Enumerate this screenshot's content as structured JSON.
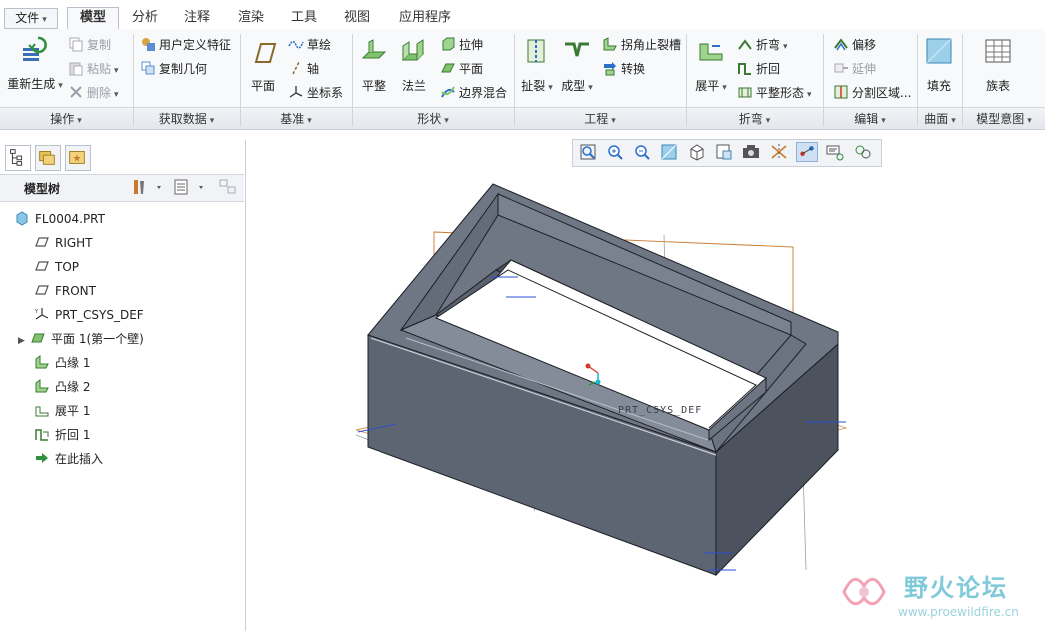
{
  "menu": {
    "file": "文件",
    "tabs": [
      "模型",
      "分析",
      "注释",
      "渲染",
      "工具",
      "视图",
      "应用程序"
    ],
    "active_tab": "模型"
  },
  "ribbon": {
    "operations": {
      "regenerate": "重新生成",
      "copy": "复制",
      "paste": "粘贴",
      "delete": "删除",
      "label": "操作"
    },
    "get_data": {
      "udf": "用户定义特征",
      "copy_geom": "复制几何",
      "label": "获取数据"
    },
    "datum": {
      "plane": "平面",
      "sketch": "草绘",
      "axis": "轴",
      "csys": "坐标系",
      "label": "基准"
    },
    "shapes": {
      "flat": "平整",
      "flange": "法兰",
      "extrude": "拉伸",
      "planar": "平面",
      "blend": "边界混合",
      "label": "形状"
    },
    "engineering": {
      "rip": "扯裂",
      "form": "成型",
      "corner_relief": "拐角止裂槽",
      "convert": "转换",
      "label": "工程"
    },
    "bend": {
      "unbend": "展平",
      "bend": "折弯",
      "bend_back": "折回",
      "flat_state": "平整形态",
      "label": "折弯"
    },
    "edit": {
      "offset": "偏移",
      "extend": "延伸",
      "split": "分割区域...",
      "label": "编辑"
    },
    "surface": {
      "fill": "填充",
      "label": "曲面"
    },
    "model_intent": {
      "family": "族表",
      "label": "模型意图"
    }
  },
  "tree": {
    "title": "模型树",
    "items": [
      {
        "label": "FL0004.PRT",
        "icon": "part-icon"
      },
      {
        "label": "RIGHT",
        "icon": "datum-plane-icon"
      },
      {
        "label": "TOP",
        "icon": "datum-plane-icon"
      },
      {
        "label": "FRONT",
        "icon": "datum-plane-icon"
      },
      {
        "label": "PRT_CSYS_DEF",
        "icon": "csys-icon"
      },
      {
        "label": "平面 1(第一个壁)",
        "icon": "flat-wall-icon"
      },
      {
        "label": "凸缘 1",
        "icon": "flange-icon"
      },
      {
        "label": "凸缘 2",
        "icon": "flange-icon"
      },
      {
        "label": "展平 1",
        "icon": "unbend-icon"
      },
      {
        "label": "折回 1",
        "icon": "bendback-icon"
      },
      {
        "label": "在此插入",
        "icon": "insert-arrow-icon"
      }
    ]
  },
  "viewport": {
    "csys_label": "PRT_CSYS_DEF"
  },
  "watermark": {
    "cn": "野火论坛",
    "url": "www.proewildfire.cn"
  },
  "colors": {
    "part_face": "#5d6472",
    "part_top": "#6f7684",
    "part_edge": "#1c1f26",
    "datum_orange": "#c8782d",
    "accent_blue": "#2a6fc9",
    "watermark": "#7fc9d8"
  }
}
